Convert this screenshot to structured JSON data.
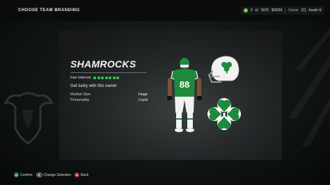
{
  "header": {
    "title": "CHOOSE TEAM BRANDING",
    "hud": {
      "level": "0",
      "coins": "5975",
      "money": "$200M",
      "owner_label": "Owner",
      "owner_tag": "[C]",
      "owner_name": "Austin E"
    }
  },
  "team": {
    "name": "SHAMROCKS",
    "fan_interest_label": "Fan Interest",
    "fan_interest_stars": 7,
    "tagline": "Get lucky with this name!",
    "attributes": [
      {
        "label": "Market Size",
        "value": "Huge"
      },
      {
        "label": "Personality",
        "value": "Loyal"
      }
    ],
    "jersey_number": "88"
  },
  "colors": {
    "primary_green": "#1f8a3c",
    "accent_green": "#2fc94a",
    "white": "#ffffff"
  },
  "footer": {
    "confirm": {
      "icon": "a-button-icon",
      "glyph": "A",
      "label": "Confirm"
    },
    "change": {
      "icon": "view-button-icon",
      "glyph": "⧉",
      "label": "Change Selection"
    },
    "back": {
      "icon": "b-button-icon",
      "glyph": "B",
      "label": "Back"
    }
  }
}
